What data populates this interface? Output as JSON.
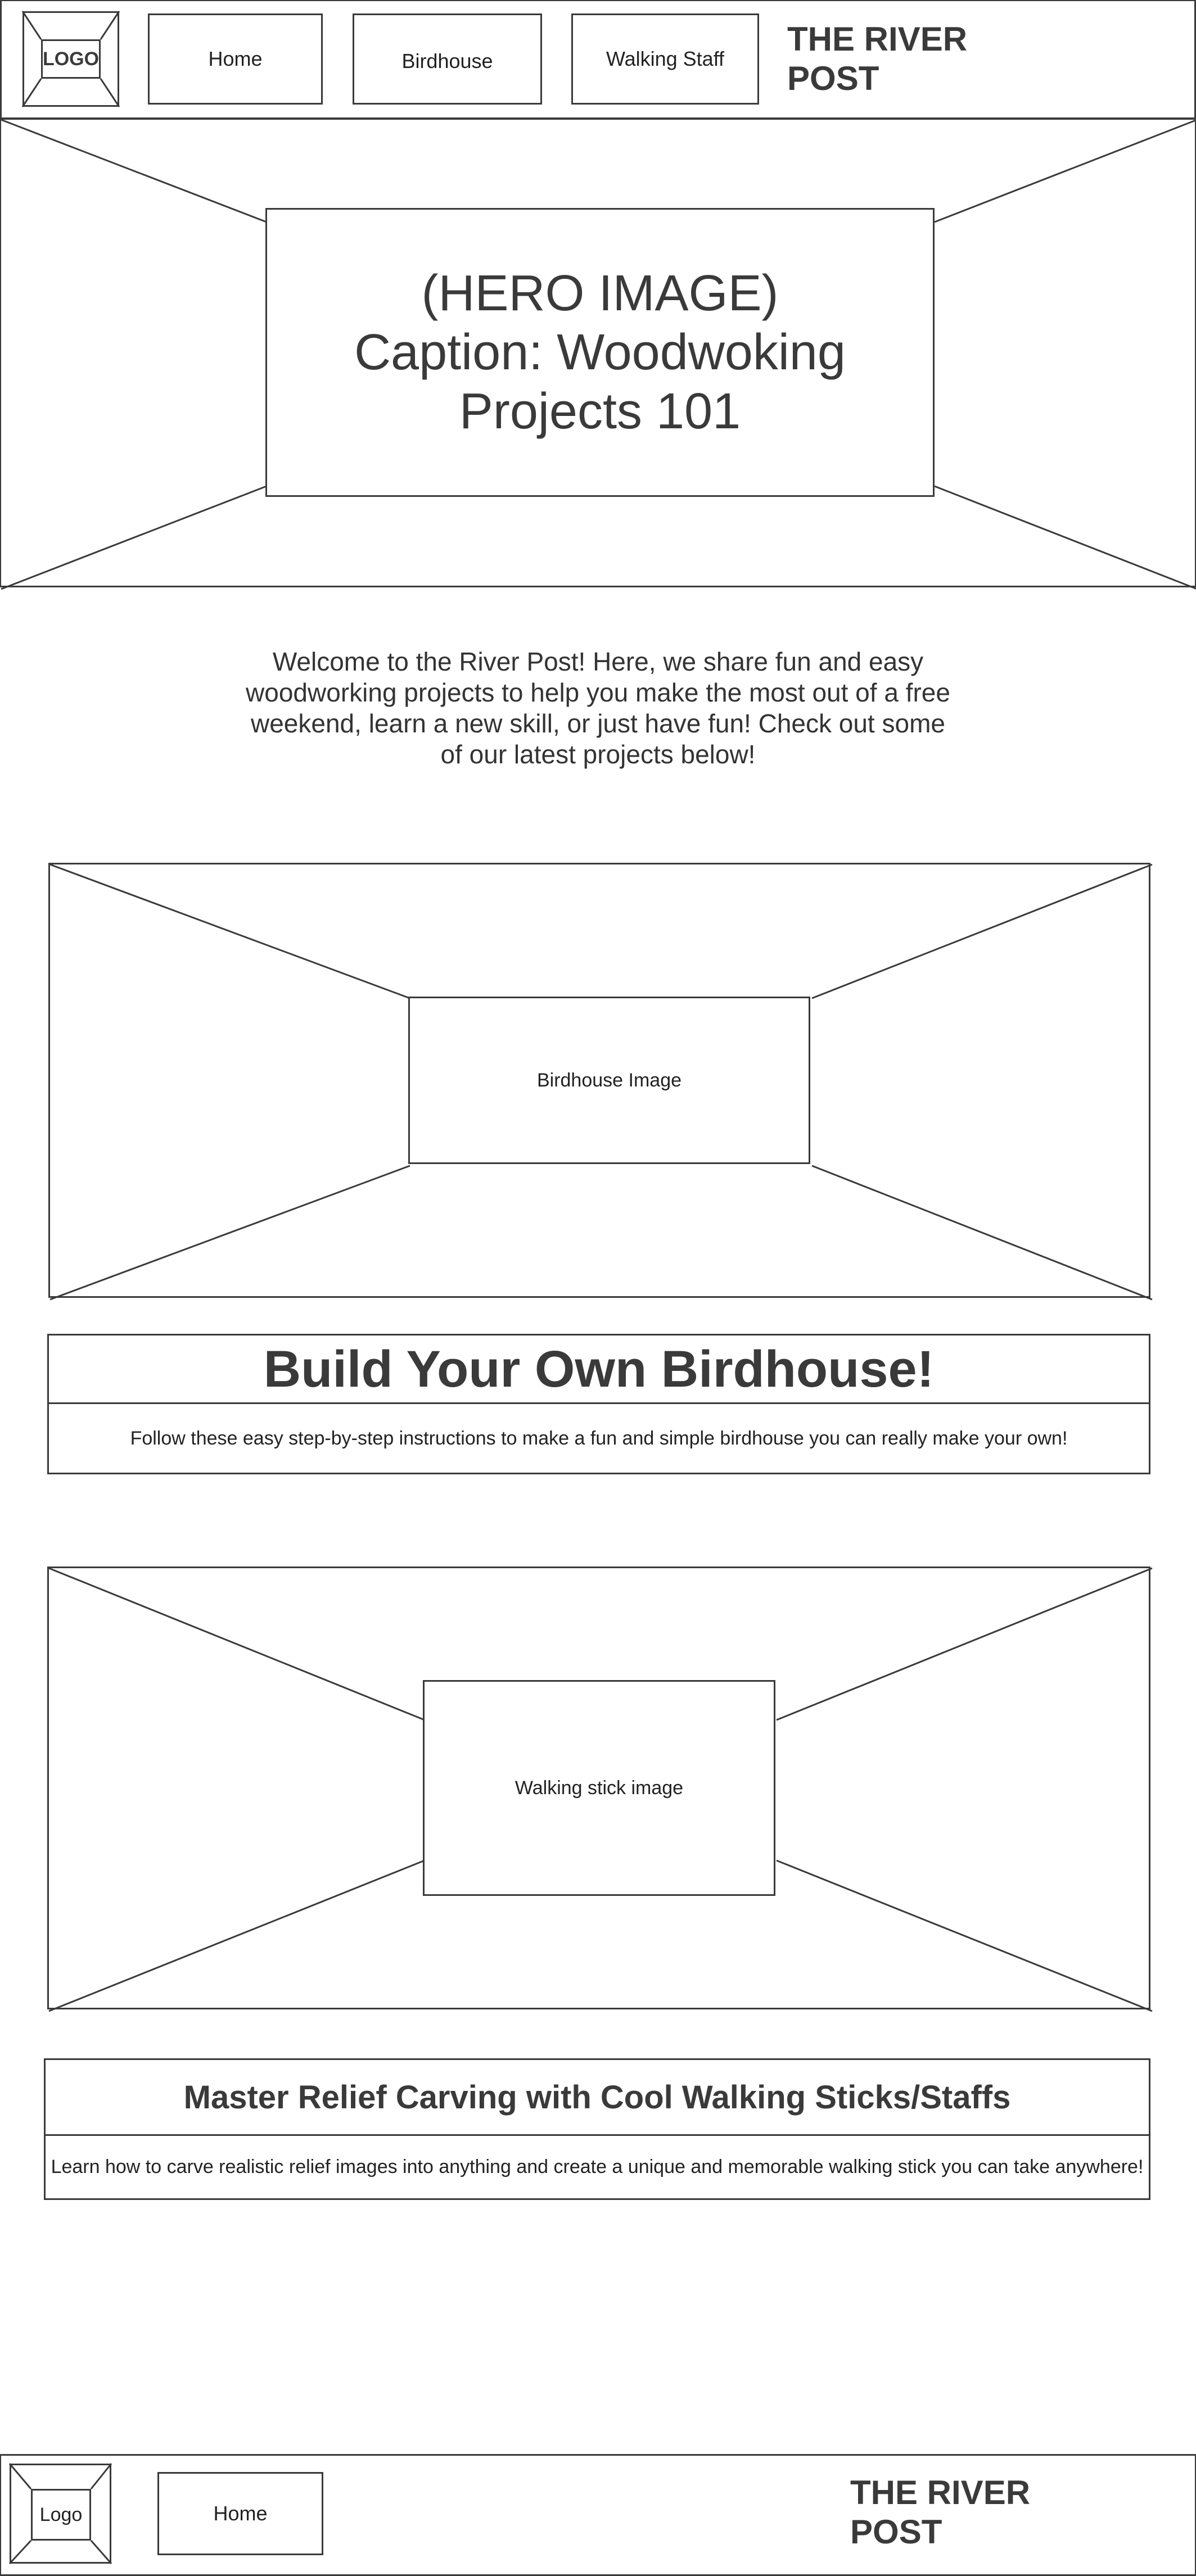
{
  "header": {
    "logo_label": "LOGO",
    "nav": {
      "home": "Home",
      "birdhouse": "Birdhouse",
      "walking_staff": "Walking Staff"
    },
    "brand_line1": "THE RIVER",
    "brand_line2": "POST"
  },
  "hero": {
    "line1": "(HERO IMAGE)",
    "line2": "Caption: Woodwoking",
    "line3": "Projects 101"
  },
  "intro": {
    "line1": "Welcome to the River Post! Here, we share fun and easy",
    "line2": "woodworking projects to help you make the most out of a free",
    "line3": "weekend, learn a new skill, or just have fun! Check out some",
    "line4": "of our latest projects below!"
  },
  "projects": [
    {
      "image_label": "Birdhouse Image",
      "title": "Build Your Own Birdhouse!",
      "description": "Follow these easy step-by-step instructions to make a fun and simple birdhouse you can really make your own!"
    },
    {
      "image_label": "Walking stick image",
      "title": "Master Relief Carving with Cool Walking Sticks/Staffs",
      "description": "Learn how to carve realistic relief images into anything and create a unique and memorable walking stick you can take anywhere!"
    }
  ],
  "footer": {
    "logo_label": "Logo",
    "nav_home": "Home",
    "brand_line1": "THE RIVER",
    "brand_line2": "POST"
  },
  "colors": {
    "stroke": "#3a3a3a",
    "background": "#ffffff",
    "text": "#222222"
  }
}
